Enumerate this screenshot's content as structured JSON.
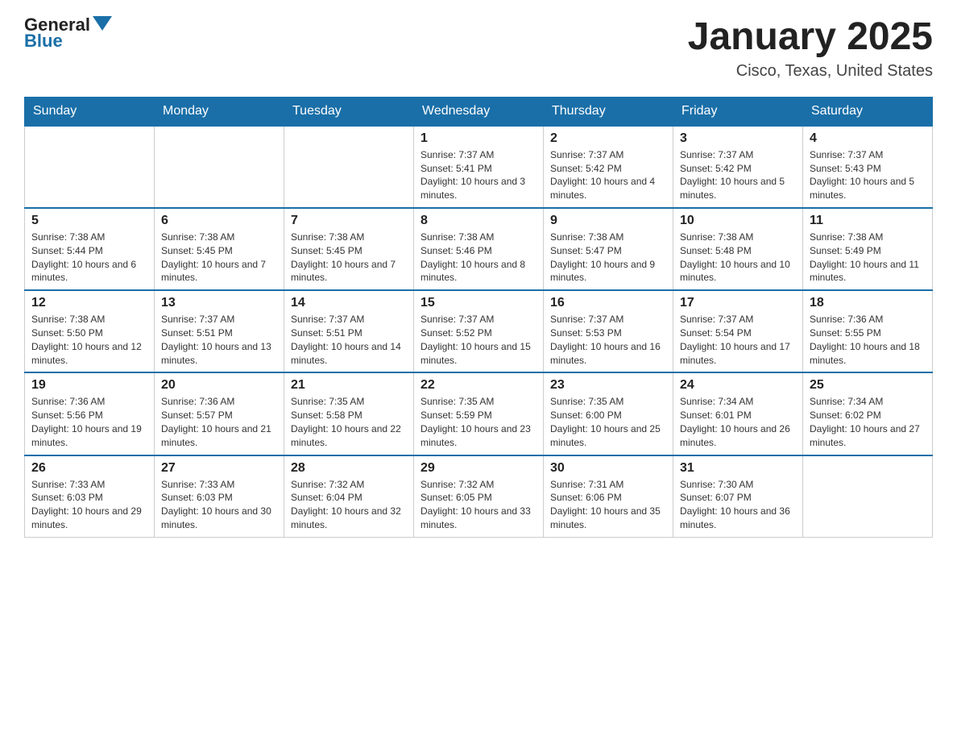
{
  "header": {
    "logo_general": "General",
    "logo_blue": "Blue",
    "month_title": "January 2025",
    "location": "Cisco, Texas, United States"
  },
  "days_of_week": [
    "Sunday",
    "Monday",
    "Tuesday",
    "Wednesday",
    "Thursday",
    "Friday",
    "Saturday"
  ],
  "weeks": [
    [
      {
        "day": "",
        "info": ""
      },
      {
        "day": "",
        "info": ""
      },
      {
        "day": "",
        "info": ""
      },
      {
        "day": "1",
        "info": "Sunrise: 7:37 AM\nSunset: 5:41 PM\nDaylight: 10 hours and 3 minutes."
      },
      {
        "day": "2",
        "info": "Sunrise: 7:37 AM\nSunset: 5:42 PM\nDaylight: 10 hours and 4 minutes."
      },
      {
        "day": "3",
        "info": "Sunrise: 7:37 AM\nSunset: 5:42 PM\nDaylight: 10 hours and 5 minutes."
      },
      {
        "day": "4",
        "info": "Sunrise: 7:37 AM\nSunset: 5:43 PM\nDaylight: 10 hours and 5 minutes."
      }
    ],
    [
      {
        "day": "5",
        "info": "Sunrise: 7:38 AM\nSunset: 5:44 PM\nDaylight: 10 hours and 6 minutes."
      },
      {
        "day": "6",
        "info": "Sunrise: 7:38 AM\nSunset: 5:45 PM\nDaylight: 10 hours and 7 minutes."
      },
      {
        "day": "7",
        "info": "Sunrise: 7:38 AM\nSunset: 5:45 PM\nDaylight: 10 hours and 7 minutes."
      },
      {
        "day": "8",
        "info": "Sunrise: 7:38 AM\nSunset: 5:46 PM\nDaylight: 10 hours and 8 minutes."
      },
      {
        "day": "9",
        "info": "Sunrise: 7:38 AM\nSunset: 5:47 PM\nDaylight: 10 hours and 9 minutes."
      },
      {
        "day": "10",
        "info": "Sunrise: 7:38 AM\nSunset: 5:48 PM\nDaylight: 10 hours and 10 minutes."
      },
      {
        "day": "11",
        "info": "Sunrise: 7:38 AM\nSunset: 5:49 PM\nDaylight: 10 hours and 11 minutes."
      }
    ],
    [
      {
        "day": "12",
        "info": "Sunrise: 7:38 AM\nSunset: 5:50 PM\nDaylight: 10 hours and 12 minutes."
      },
      {
        "day": "13",
        "info": "Sunrise: 7:37 AM\nSunset: 5:51 PM\nDaylight: 10 hours and 13 minutes."
      },
      {
        "day": "14",
        "info": "Sunrise: 7:37 AM\nSunset: 5:51 PM\nDaylight: 10 hours and 14 minutes."
      },
      {
        "day": "15",
        "info": "Sunrise: 7:37 AM\nSunset: 5:52 PM\nDaylight: 10 hours and 15 minutes."
      },
      {
        "day": "16",
        "info": "Sunrise: 7:37 AM\nSunset: 5:53 PM\nDaylight: 10 hours and 16 minutes."
      },
      {
        "day": "17",
        "info": "Sunrise: 7:37 AM\nSunset: 5:54 PM\nDaylight: 10 hours and 17 minutes."
      },
      {
        "day": "18",
        "info": "Sunrise: 7:36 AM\nSunset: 5:55 PM\nDaylight: 10 hours and 18 minutes."
      }
    ],
    [
      {
        "day": "19",
        "info": "Sunrise: 7:36 AM\nSunset: 5:56 PM\nDaylight: 10 hours and 19 minutes."
      },
      {
        "day": "20",
        "info": "Sunrise: 7:36 AM\nSunset: 5:57 PM\nDaylight: 10 hours and 21 minutes."
      },
      {
        "day": "21",
        "info": "Sunrise: 7:35 AM\nSunset: 5:58 PM\nDaylight: 10 hours and 22 minutes."
      },
      {
        "day": "22",
        "info": "Sunrise: 7:35 AM\nSunset: 5:59 PM\nDaylight: 10 hours and 23 minutes."
      },
      {
        "day": "23",
        "info": "Sunrise: 7:35 AM\nSunset: 6:00 PM\nDaylight: 10 hours and 25 minutes."
      },
      {
        "day": "24",
        "info": "Sunrise: 7:34 AM\nSunset: 6:01 PM\nDaylight: 10 hours and 26 minutes."
      },
      {
        "day": "25",
        "info": "Sunrise: 7:34 AM\nSunset: 6:02 PM\nDaylight: 10 hours and 27 minutes."
      }
    ],
    [
      {
        "day": "26",
        "info": "Sunrise: 7:33 AM\nSunset: 6:03 PM\nDaylight: 10 hours and 29 minutes."
      },
      {
        "day": "27",
        "info": "Sunrise: 7:33 AM\nSunset: 6:03 PM\nDaylight: 10 hours and 30 minutes."
      },
      {
        "day": "28",
        "info": "Sunrise: 7:32 AM\nSunset: 6:04 PM\nDaylight: 10 hours and 32 minutes."
      },
      {
        "day": "29",
        "info": "Sunrise: 7:32 AM\nSunset: 6:05 PM\nDaylight: 10 hours and 33 minutes."
      },
      {
        "day": "30",
        "info": "Sunrise: 7:31 AM\nSunset: 6:06 PM\nDaylight: 10 hours and 35 minutes."
      },
      {
        "day": "31",
        "info": "Sunrise: 7:30 AM\nSunset: 6:07 PM\nDaylight: 10 hours and 36 minutes."
      },
      {
        "day": "",
        "info": ""
      }
    ]
  ]
}
